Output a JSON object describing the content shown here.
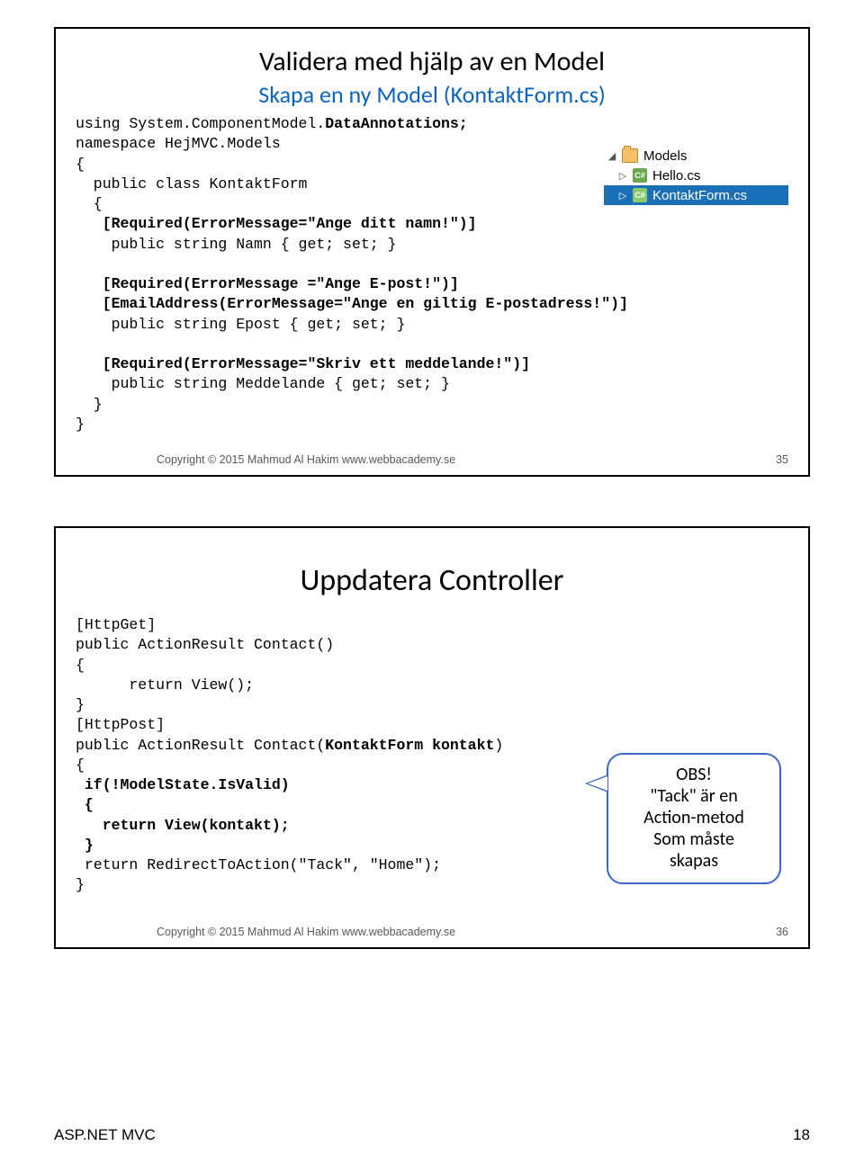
{
  "slide1": {
    "title": "Validera med hjälp av en Model",
    "subtitle": "Skapa en ny Model (KontaktForm.cs)",
    "code_lines": [
      {
        "t": "using System.ComponentModel.",
        "b": "DataAnnotations;",
        "a": ""
      },
      {
        "t": "namespace HejMVC.Models"
      },
      {
        "t": "{"
      },
      {
        "t": "  public class KontaktForm"
      },
      {
        "t": "  {"
      },
      {
        "t": "   ",
        "b": "[Required(ErrorMessage=\"Ange ditt namn!\")]"
      },
      {
        "t": "    public string Namn { get; set; }"
      },
      {
        "t": ""
      },
      {
        "t": "   ",
        "b": "[Required(ErrorMessage =\"Ange E-post!\")]"
      },
      {
        "t": "   ",
        "b": "[EmailAddress(ErrorMessage=\"Ange en giltig E-postadress!\")]"
      },
      {
        "t": "    public string Epost { get; set; }"
      },
      {
        "t": ""
      },
      {
        "t": "   ",
        "b": "[Required(ErrorMessage=\"Skriv ett meddelande!\")]"
      },
      {
        "t": "    public string Meddelande { get; set; }"
      },
      {
        "t": "  }"
      },
      {
        "t": "}"
      }
    ],
    "copyright": "Copyright © 2015 Mahmud Al Hakim www.webbacademy.se",
    "slide_no": "35",
    "explorer": {
      "folder": "Models",
      "file1": "Hello.cs",
      "file2": "KontaktForm.cs"
    }
  },
  "slide2": {
    "title": "Uppdatera Controller",
    "code_lines": [
      {
        "t": "[HttpGet]"
      },
      {
        "t": "public ActionResult Contact()"
      },
      {
        "t": "{"
      },
      {
        "t": "      return View();"
      },
      {
        "t": "}"
      },
      {
        "t": "[HttpPost]"
      },
      {
        "t": "public ActionResult Contact(",
        "b": "KontaktForm kontakt",
        "a": ")"
      },
      {
        "t": "{"
      },
      {
        "t": " ",
        "b": "if(!ModelState.IsValid)"
      },
      {
        "t": " ",
        "b": "{"
      },
      {
        "t": "   ",
        "b": "return View(kontakt);"
      },
      {
        "t": " ",
        "b": "}"
      },
      {
        "t": " return RedirectToAction(\"Tack\", \"Home\");"
      },
      {
        "t": "}"
      }
    ],
    "callout": {
      "l1": "OBS!",
      "l2": "\"Tack\" är en",
      "l3": "Action-metod",
      "l4": "Som måste",
      "l5": "skapas"
    },
    "copyright": "Copyright © 2015 Mahmud Al Hakim www.webbacademy.se",
    "slide_no": "36"
  },
  "page_footer": {
    "left": "ASP.NET MVC",
    "right": "18"
  }
}
